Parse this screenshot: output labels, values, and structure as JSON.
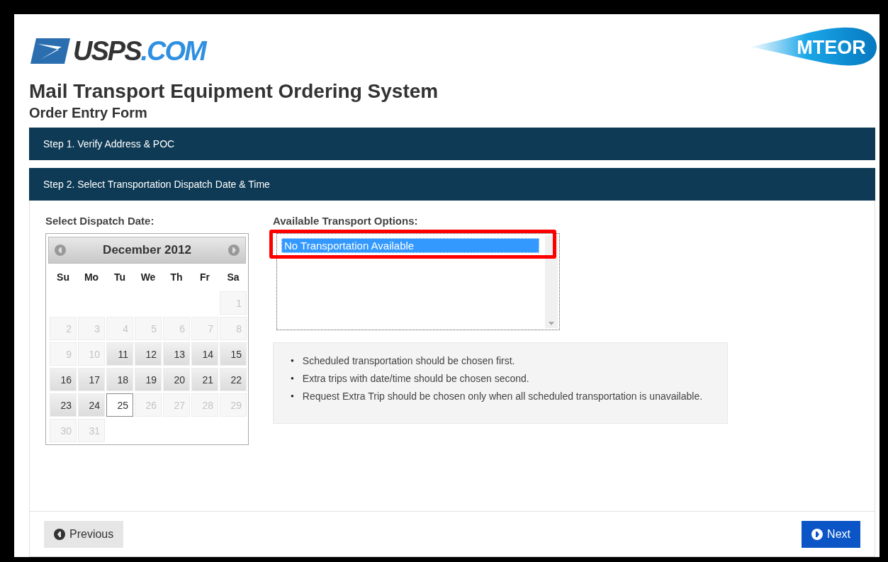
{
  "logo": {
    "main": "USPS",
    "suffix": ".COM"
  },
  "badge": {
    "text": "MTEOR"
  },
  "title": "Mail Transport Equipment Ordering System",
  "subtitle": "Order Entry Form",
  "steps": [
    {
      "label": "Step 1. Verify Address & POC"
    },
    {
      "label": "Step 2. Select Transportation Dispatch Date & Time"
    }
  ],
  "date_label": "Select Dispatch Date:",
  "calendar": {
    "month": "December 2012",
    "weekdays": [
      "Su",
      "Mo",
      "Tu",
      "We",
      "Th",
      "Fr",
      "Sa"
    ],
    "weeks": [
      [
        {
          "kind": "blank"
        },
        {
          "kind": "blank"
        },
        {
          "kind": "blank"
        },
        {
          "kind": "blank"
        },
        {
          "kind": "blank"
        },
        {
          "kind": "blank"
        },
        {
          "kind": "day",
          "day": "1",
          "disabled": true,
          "selected": false
        }
      ],
      [
        {
          "kind": "day",
          "day": "2",
          "disabled": true,
          "selected": false
        },
        {
          "kind": "day",
          "day": "3",
          "disabled": true,
          "selected": false
        },
        {
          "kind": "day",
          "day": "4",
          "disabled": true,
          "selected": false
        },
        {
          "kind": "day",
          "day": "5",
          "disabled": true,
          "selected": false
        },
        {
          "kind": "day",
          "day": "6",
          "disabled": true,
          "selected": false
        },
        {
          "kind": "day",
          "day": "7",
          "disabled": true,
          "selected": false
        },
        {
          "kind": "day",
          "day": "8",
          "disabled": true,
          "selected": false
        }
      ],
      [
        {
          "kind": "day",
          "day": "9",
          "disabled": true,
          "selected": false
        },
        {
          "kind": "day",
          "day": "10",
          "disabled": true,
          "selected": false
        },
        {
          "kind": "day",
          "day": "11",
          "disabled": false,
          "selected": false
        },
        {
          "kind": "day",
          "day": "12",
          "disabled": false,
          "selected": false
        },
        {
          "kind": "day",
          "day": "13",
          "disabled": false,
          "selected": false
        },
        {
          "kind": "day",
          "day": "14",
          "disabled": false,
          "selected": false
        },
        {
          "kind": "day",
          "day": "15",
          "disabled": false,
          "selected": false
        }
      ],
      [
        {
          "kind": "day",
          "day": "16",
          "disabled": false,
          "selected": false
        },
        {
          "kind": "day",
          "day": "17",
          "disabled": false,
          "selected": false
        },
        {
          "kind": "day",
          "day": "18",
          "disabled": false,
          "selected": false
        },
        {
          "kind": "day",
          "day": "19",
          "disabled": false,
          "selected": false
        },
        {
          "kind": "day",
          "day": "20",
          "disabled": false,
          "selected": false
        },
        {
          "kind": "day",
          "day": "21",
          "disabled": false,
          "selected": false
        },
        {
          "kind": "day",
          "day": "22",
          "disabled": false,
          "selected": false
        }
      ],
      [
        {
          "kind": "day",
          "day": "23",
          "disabled": false,
          "selected": false
        },
        {
          "kind": "day",
          "day": "24",
          "disabled": false,
          "selected": false
        },
        {
          "kind": "day",
          "day": "25",
          "disabled": false,
          "selected": true
        },
        {
          "kind": "day",
          "day": "26",
          "disabled": true,
          "selected": false
        },
        {
          "kind": "day",
          "day": "27",
          "disabled": true,
          "selected": false
        },
        {
          "kind": "day",
          "day": "28",
          "disabled": true,
          "selected": false
        },
        {
          "kind": "day",
          "day": "29",
          "disabled": true,
          "selected": false
        }
      ],
      [
        {
          "kind": "day",
          "day": "30",
          "disabled": true,
          "selected": false
        },
        {
          "kind": "day",
          "day": "31",
          "disabled": true,
          "selected": false
        }
      ]
    ]
  },
  "options_label": "Available Transport Options:",
  "options": [
    {
      "label": "No Transportation Available",
      "selected": true,
      "highlighted": true
    }
  ],
  "notes": [
    {
      "bullet": "●",
      "text": "Scheduled transportation should be chosen first."
    },
    {
      "bullet": "●",
      "text": "Extra trips with date/time should be chosen second."
    },
    {
      "bullet": "●",
      "text": "Request Extra Trip should be chosen only when all scheduled transportation is unavailable."
    }
  ],
  "buttons": {
    "previous": "Previous",
    "next": "Next"
  }
}
